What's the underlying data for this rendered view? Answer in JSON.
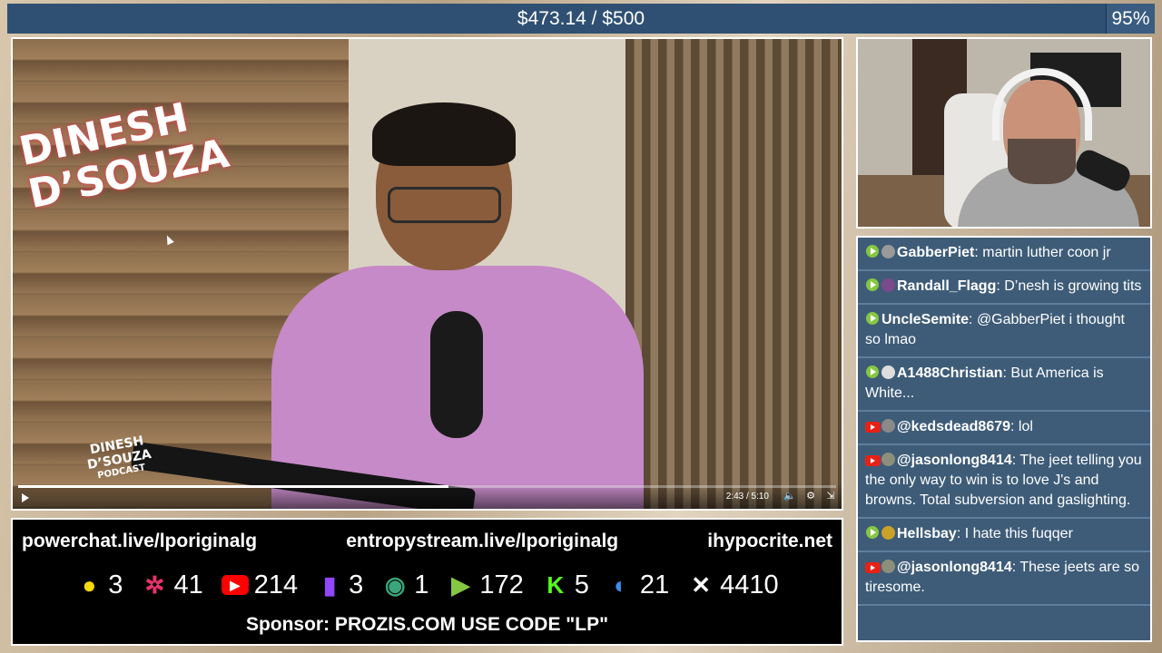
{
  "goal": {
    "text": "$473.14 / $500",
    "percent_label": "95%",
    "progress": 0.95
  },
  "video": {
    "logo_line1": "DINESH",
    "logo_line2": "D’SOUZA",
    "podcast_brand": "DINESH D’SOUZA",
    "podcast_sub": "PODCAST",
    "time": "2:43 / 5:10",
    "progress": 0.526
  },
  "chat": {
    "messages": [
      {
        "platform": "rumble",
        "avatar_color": "#9a9a9a",
        "name": "GabberPiet",
        "text": ": martin luther coon jr"
      },
      {
        "platform": "rumble",
        "avatar_color": "#7a4a8a",
        "name": "Randall_Flagg",
        "text": ": D’nesh is growing tits"
      },
      {
        "platform": "rumble",
        "avatar_color": "",
        "name": "UncleSemite",
        "text": ": @GabberPiet i thought so lmao"
      },
      {
        "platform": "rumble",
        "avatar_color": "#dddddd",
        "name": "A1488Christian",
        "text": ": But America is White..."
      },
      {
        "platform": "youtube",
        "avatar_color": "#8a8a8a",
        "name": "@kedsdead8679",
        "text": ": lol"
      },
      {
        "platform": "youtube",
        "avatar_color": "#8c8f7a",
        "name": "@jasonlong8414",
        "text": ": The jeet telling you the only way to win is to love J's and browns. Total subversion and gaslighting."
      },
      {
        "platform": "rumble",
        "avatar_color": "#c9a227",
        "name": "Hellsbay",
        "text": ": I hate this fuqqer"
      },
      {
        "platform": "youtube",
        "avatar_color": "#8c8f7a",
        "name": "@jasonlong8414",
        "text": ": These jeets are so tiresome."
      }
    ]
  },
  "info": {
    "links": [
      "powerchat.live/lporiginalg",
      "entropystream.live/lporiginalg",
      "ihypocrite.net"
    ],
    "stats": [
      {
        "icon": "robot-face-icon",
        "color": "#f5d90a",
        "value": "3"
      },
      {
        "icon": "dancer-icon",
        "color": "#e8336b",
        "value": "41"
      },
      {
        "icon": "youtube-icon",
        "color": "#ff0000",
        "value": "214"
      },
      {
        "icon": "twitch-icon",
        "color": "#9146ff",
        "value": "3"
      },
      {
        "icon": "globe-icon",
        "color": "#3aa57a",
        "value": "1"
      },
      {
        "icon": "rumble-icon",
        "color": "#85c742",
        "value": "172"
      },
      {
        "icon": "kick-icon",
        "color": "#53fc18",
        "value": "5"
      },
      {
        "icon": "moon-icon",
        "color": "#3d8ee8",
        "value": "21"
      },
      {
        "icon": "x-icon",
        "color": "#ffffff",
        "value": "4410"
      }
    ],
    "sponsor": "Sponsor: PROZIS.COM USE CODE \"LP\""
  }
}
